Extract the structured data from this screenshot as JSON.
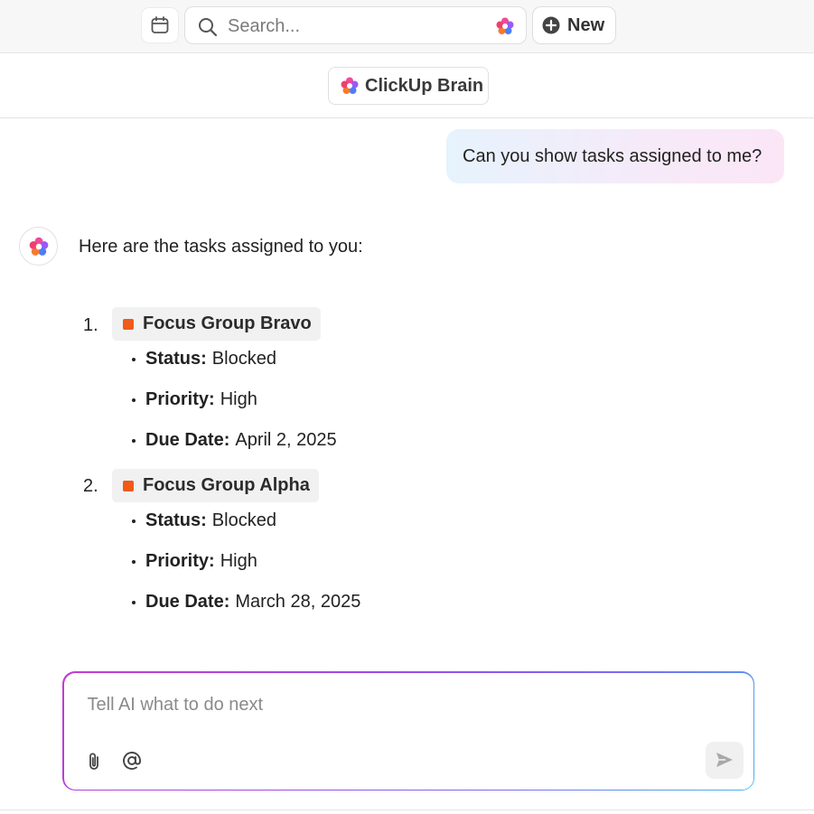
{
  "topbar": {
    "search_placeholder": "Search...",
    "new_label": "New",
    "icons": {
      "calendar": "calendar-icon",
      "search": "search-icon",
      "brain": "clickup-brain-icon",
      "plus": "plus-circle-icon"
    }
  },
  "header": {
    "title": "ClickUp Brain"
  },
  "conversation": {
    "user_message": "Can you show tasks assigned to me?",
    "ai_intro": "Here are the tasks assigned to you:",
    "tasks": [
      {
        "number": "1.",
        "name": "Focus Group Bravo",
        "status_color": "#f05a1a",
        "fields": [
          {
            "label": "Status:",
            "value": "Blocked"
          },
          {
            "label": "Priority:",
            "value": "High"
          },
          {
            "label": "Due Date:",
            "value": "April 2, 2025"
          }
        ]
      },
      {
        "number": "2.",
        "name": "Focus Group Alpha",
        "status_color": "#f05a1a",
        "fields": [
          {
            "label": "Status:",
            "value": "Blocked"
          },
          {
            "label": "Priority:",
            "value": "High"
          },
          {
            "label": "Due Date:",
            "value": "March 28, 2025"
          }
        ]
      }
    ]
  },
  "composer": {
    "placeholder": "Tell AI what to do next",
    "icons": {
      "attach": "paperclip-icon",
      "mention": "at-sign-icon",
      "send": "send-icon"
    }
  }
}
